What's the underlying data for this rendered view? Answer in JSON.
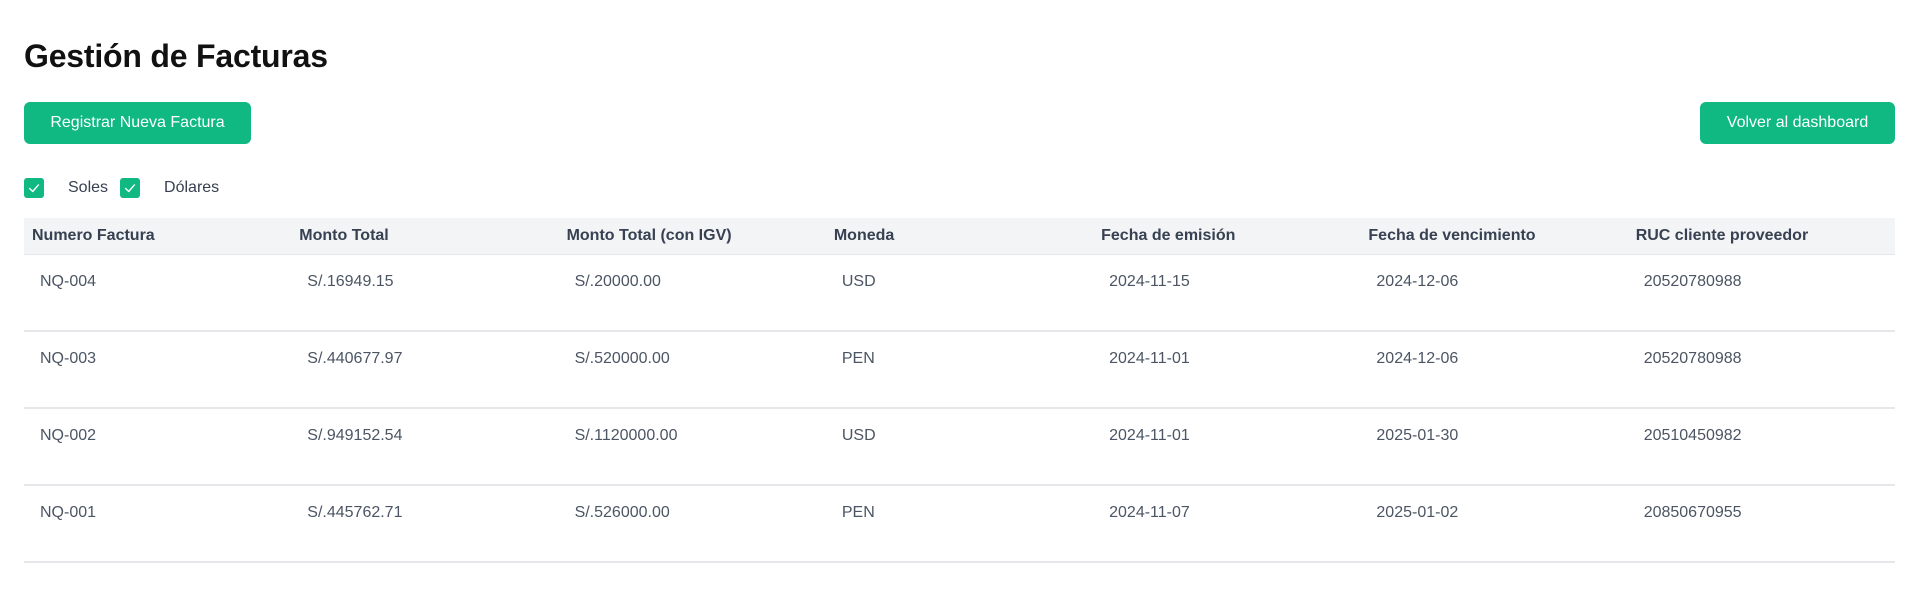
{
  "page": {
    "title": "Gestión de Facturas"
  },
  "toolbar": {
    "register_label": "Registrar Nueva Factura",
    "back_label": "Volver al dashboard"
  },
  "filters": {
    "soles": {
      "label": "Soles",
      "checked": true
    },
    "dolares": {
      "label": "Dólares",
      "checked": true
    }
  },
  "table": {
    "headers": [
      "Numero Factura",
      "Monto Total",
      "Monto Total (con IGV)",
      "Moneda",
      "Fecha de emisión",
      "Fecha de vencimiento",
      "RUC cliente proveedor"
    ],
    "rows": [
      [
        "NQ-004",
        "S/.16949.15",
        "S/.20000.00",
        "USD",
        "2024-11-15",
        "2024-12-06",
        "20520780988"
      ],
      [
        "NQ-003",
        "S/.440677.97",
        "S/.520000.00",
        "PEN",
        "2024-11-01",
        "2024-12-06",
        "20520780988"
      ],
      [
        "NQ-002",
        "S/.949152.54",
        "S/.1120000.00",
        "USD",
        "2024-11-01",
        "2025-01-30",
        "20510450982"
      ],
      [
        "NQ-001",
        "S/.445762.71",
        "S/.526000.00",
        "PEN",
        "2024-11-07",
        "2025-01-02",
        "20850670955"
      ]
    ]
  },
  "colors": {
    "accent": "#10b981",
    "header_bg": "#f3f4f6",
    "row_border": "#e5e7eb"
  },
  "icons": {
    "checkbox": "check-icon"
  }
}
